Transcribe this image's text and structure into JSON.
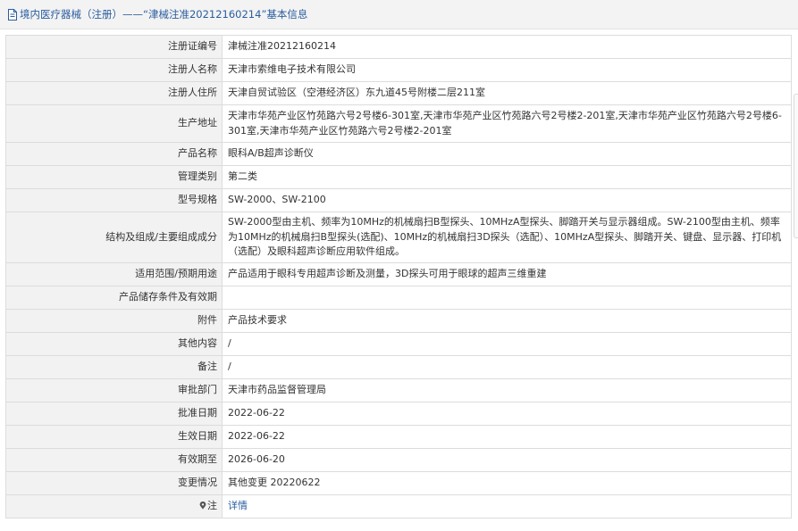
{
  "header": {
    "title": "境内医疗器械（注册）——“津械注准20212160214”基本信息"
  },
  "rows": [
    {
      "label": "注册证编号",
      "value": "津械注准20212160214"
    },
    {
      "label": "注册人名称",
      "value": "天津市索维电子技术有限公司"
    },
    {
      "label": "注册人住所",
      "value": "天津自贸试验区（空港经济区）东九道45号附楼二层211室"
    },
    {
      "label": "生产地址",
      "value": "天津市华苑产业区竹苑路六号2号楼6-301室,天津市华苑产业区竹苑路六号2号楼2-201室,天津市华苑产业区竹苑路六号2号楼6-301室,天津市华苑产业区竹苑路六号2号楼2-201室"
    },
    {
      "label": "产品名称",
      "value": "眼科A/B超声诊断仪"
    },
    {
      "label": "管理类别",
      "value": "第二类"
    },
    {
      "label": "型号规格",
      "value": "SW-2000、SW-2100"
    },
    {
      "label": "结构及组成/主要组成成分",
      "value": "SW-2000型由主机、频率为10MHz的机械扇扫B型探头、10MHzA型探头、脚踏开关与显示器组成。SW-2100型由主机、频率为10MHz的机械扇扫B型探头(选配)、10MHz的机械扇扫3D探头（选配）、10MHzA型探头、脚踏开关、键盘、显示器、打印机（选配）及眼科超声诊断应用软件组成。"
    },
    {
      "label": "适用范围/预期用途",
      "value": "产品适用于眼科专用超声诊断及测量，3D探头可用于眼球的超声三维重建"
    },
    {
      "label": "产品储存条件及有效期",
      "value": ""
    },
    {
      "label": "附件",
      "value": "产品技术要求"
    },
    {
      "label": "其他内容",
      "value": "/"
    },
    {
      "label": "备注",
      "value": "/"
    },
    {
      "label": "审批部门",
      "value": "天津市药品监督管理局"
    },
    {
      "label": "批准日期",
      "value": "2022-06-22"
    },
    {
      "label": "生效日期",
      "value": "2022-06-22"
    },
    {
      "label": "有效期至",
      "value": "2026-06-20"
    },
    {
      "label": "变更情况",
      "value": "其他变更 20220622"
    },
    {
      "label": "注",
      "value": "详情",
      "icon": "map-pin-icon"
    }
  ]
}
